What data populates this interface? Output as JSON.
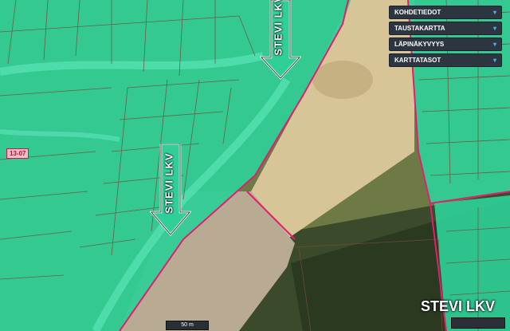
{
  "layer_panel": {
    "items": [
      {
        "label": "KOHDETIEDOT"
      },
      {
        "label": "TAUSTAKARTTA"
      },
      {
        "label": "LÄPINÄKYVYYS"
      },
      {
        "label": "KARTTATASOT"
      }
    ],
    "chevron": "▾"
  },
  "arrow_labels": {
    "upper": "STEVI LKV",
    "lower": "STEVI LKV"
  },
  "big_label": "STEVI LKV",
  "zone_code": "13-07",
  "scale": "50 m",
  "colors": {
    "parcel_fill": "#2fcf97",
    "parcel_line": "#7a4a3a",
    "boundary": "#e0206f",
    "field_light": "#d8c597",
    "field_bare": "#b9aa94",
    "forest": "#2c3d22",
    "panel_bg": "#2c3540",
    "accent": "#4fb3e8"
  },
  "icons": [
    "down-arrow-icon",
    "chevron-down-icon"
  ]
}
